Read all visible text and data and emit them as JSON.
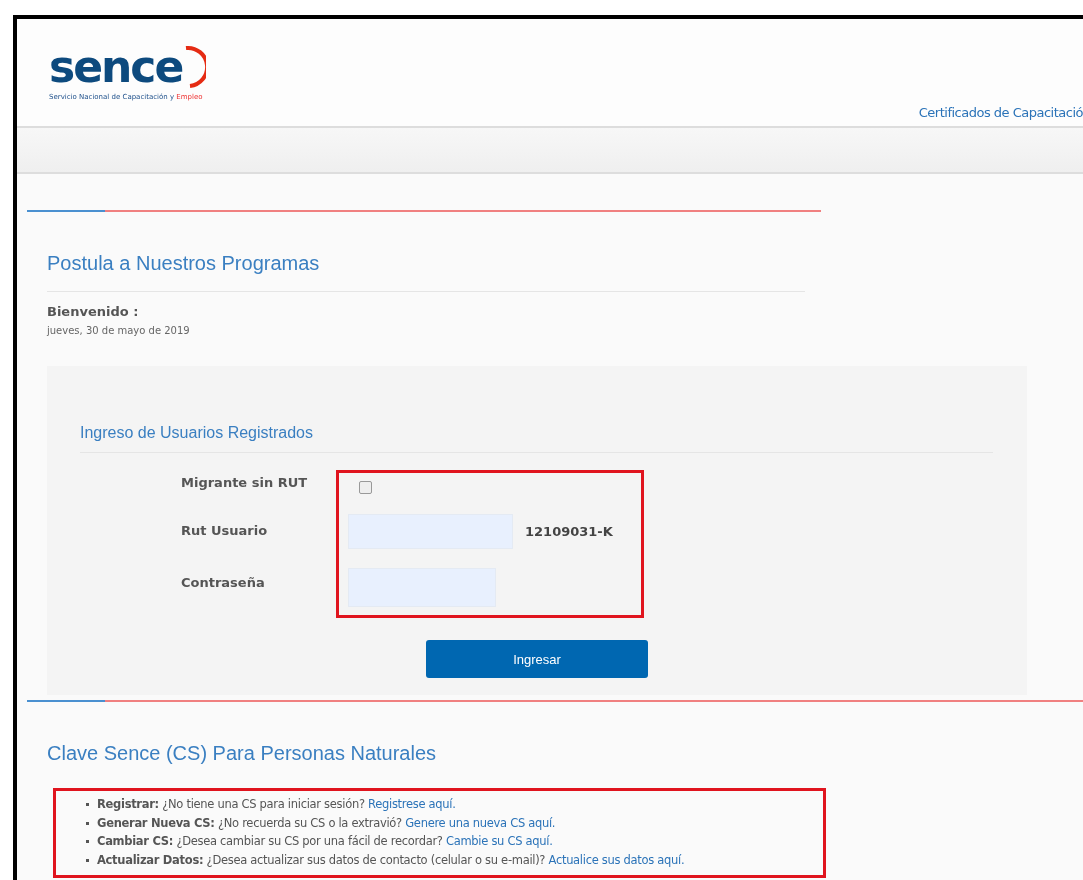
{
  "header": {
    "logo": {
      "wordmark": "sence",
      "tagline": "Servicio Nacional de Capacitación y",
      "tagline_accent": "Empleo"
    },
    "link": "Certificados de Capacitació"
  },
  "intro": {
    "title": "Postula a Nuestros Programas",
    "welcome": "Bienvenido :",
    "date": "jueves, 30 de mayo de 2019"
  },
  "login": {
    "title": "Ingreso de Usuarios Registrados",
    "migrant": {
      "label": "Migrante sin RUT",
      "checked": false
    },
    "rut": {
      "label": "Rut Usuario",
      "note": "12109031-K"
    },
    "password": {
      "label": "Contraseña"
    },
    "button": "Ingresar"
  },
  "clave": {
    "title": "Clave Sence (CS) Para Personas Naturales",
    "items": [
      {
        "term": "Registrar:",
        "text": "¿No tiene una CS para iniciar sesión?",
        "link": "Registrese aquí."
      },
      {
        "term": "Generar Nueva CS:",
        "text": "¿No recuerda su CS o la extravió?",
        "link": "Genere una nueva CS aquí."
      },
      {
        "term": "Cambiar CS:",
        "text": "¿Desea cambiar su CS por una fácil de recordar?",
        "link": "Cambie su CS aquí."
      },
      {
        "term": "Actualizar Datos:",
        "text": "¿Desea actualizar sus datos de contacto (celular o su e-mail)?",
        "link": "Actualice sus datos aquí."
      }
    ]
  }
}
